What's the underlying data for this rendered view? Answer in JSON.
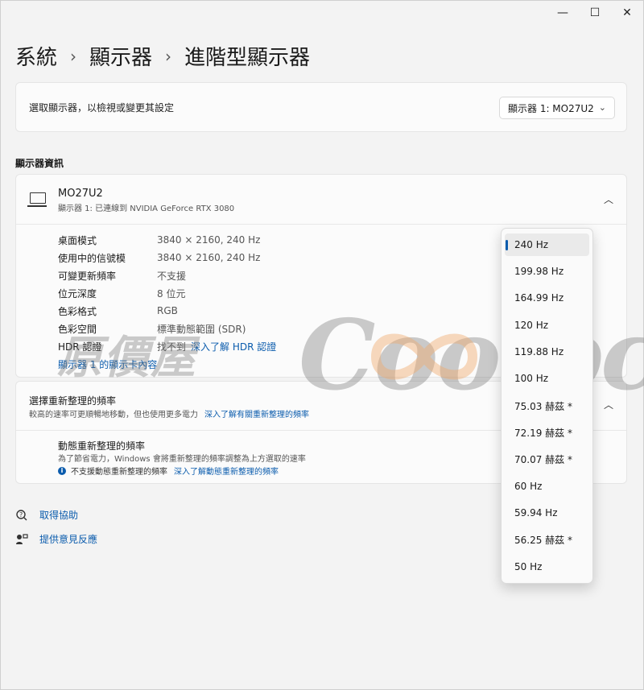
{
  "window": {
    "controls": {
      "minimize": "—",
      "maximize": "☐",
      "close": "✕"
    }
  },
  "breadcrumb": {
    "items": [
      "系統",
      "顯示器",
      "進階型顯示器"
    ],
    "separator": "›"
  },
  "select_display": {
    "label": "選取顯示器，以檢視或變更其設定",
    "value": "顯示器 1: MO27U2"
  },
  "display_info": {
    "section_title": "顯示器資訊",
    "monitor_name": "MO27U2",
    "monitor_sub": "顯示器 1: 已連線到 NVIDIA GeForce RTX 3080",
    "rows": [
      {
        "key": "桌面模式",
        "value": "3840 × 2160, 240 Hz"
      },
      {
        "key": "使用中的信號模",
        "value": "3840 × 2160, 240 Hz"
      },
      {
        "key": "可變更新頻率",
        "value": "不支援"
      },
      {
        "key": "位元深度",
        "value": "8 位元"
      },
      {
        "key": "色彩格式",
        "value": "RGB"
      },
      {
        "key": "色彩空間",
        "value": "標準動態範圍 (SDR)"
      }
    ],
    "hdr_key": "HDR 認證",
    "hdr_value": "找不到",
    "hdr_link": "深入了解 HDR 認證",
    "adapter_link": "顯示器 1 的顯示卡內容"
  },
  "refresh": {
    "title": "選擇重新整理的頻率",
    "subtitle": "較高的速率可更順暢地移動，但也使用更多電力",
    "subtitle_link": "深入了解有關重新整理的頻率",
    "dynamic_title": "動態重新整理的頻率",
    "dynamic_sub": "為了節省電力，Windows 會將重新整理的頻率調整為上方選取的速率",
    "dynamic_note": "不支援動態重新整理的頻率",
    "dynamic_link": "深入了解動態重新整理的頻率"
  },
  "help": {
    "get_help": "取得協助",
    "feedback": "提供意見反應"
  },
  "refresh_menu": {
    "selected": "240 Hz",
    "options": [
      "240 Hz",
      "199.98 Hz",
      "164.99 Hz",
      "120 Hz",
      "119.88 Hz",
      "100 Hz",
      "75.03 赫茲 *",
      "72.19 赫茲 *",
      "70.07 赫茲 *",
      "60 Hz",
      "59.94 Hz",
      "56.25 赫茲 *",
      "50 Hz"
    ]
  },
  "watermark": {
    "cn": "原價屋",
    "en": "Coolpc"
  },
  "colors": {
    "accent": "#0b5cad",
    "background": "#f3f3f3",
    "card": "#fbfbfb"
  }
}
